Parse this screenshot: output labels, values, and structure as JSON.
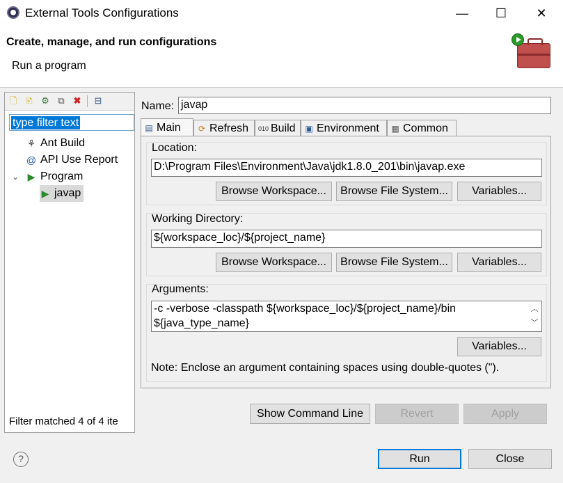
{
  "window": {
    "title": "External Tools Configurations",
    "minimize": "—",
    "maximize": "☐",
    "close": "✕"
  },
  "header": {
    "title": "Create, manage, and run configurations",
    "subtitle": "Run a program"
  },
  "sidebar": {
    "filter_placeholder": "type filter text",
    "items": [
      {
        "label": "Ant Build",
        "icon": "ant-icon"
      },
      {
        "label": "API Use Report",
        "icon": "api-report-icon"
      },
      {
        "label": "Program",
        "icon": "program-icon",
        "expanded": true
      },
      {
        "label": "javap",
        "icon": "program-config-icon",
        "selected": true
      }
    ],
    "status": "Filter matched 4 of 4 ite"
  },
  "main": {
    "name_label": "Name:",
    "name_value": "javap",
    "tabs": [
      {
        "label": "Main",
        "icon": "main-tab-icon",
        "active": true
      },
      {
        "label": "Refresh",
        "icon": "refresh-icon"
      },
      {
        "label": "Build",
        "icon": "build-icon"
      },
      {
        "label": "Environment",
        "icon": "environment-icon"
      },
      {
        "label": "Common",
        "icon": "common-icon"
      }
    ],
    "location": {
      "label": "Location:",
      "value": "D:\\Program Files\\Environment\\Java\\jdk1.8.0_201\\bin\\javap.exe",
      "browse_workspace": "Browse Workspace...",
      "browse_fs": "Browse File System...",
      "variables": "Variables..."
    },
    "workdir": {
      "label": "Working Directory:",
      "value": "${workspace_loc}/${project_name}",
      "browse_workspace": "Browse Workspace...",
      "browse_fs": "Browse File System...",
      "variables": "Variables..."
    },
    "arguments": {
      "label": "Arguments:",
      "line1": "-c -verbose -classpath ${workspace_loc}/${project_name}/bin",
      "line2": "${java_type_name}",
      "variables": "Variables...",
      "note": "Note: Enclose an argument containing spaces using double-quotes (\")."
    }
  },
  "buttons": {
    "show_command_line": "Show Command Line",
    "revert": "Revert",
    "apply": "Apply",
    "run": "Run",
    "close": "Close"
  },
  "help": "?"
}
